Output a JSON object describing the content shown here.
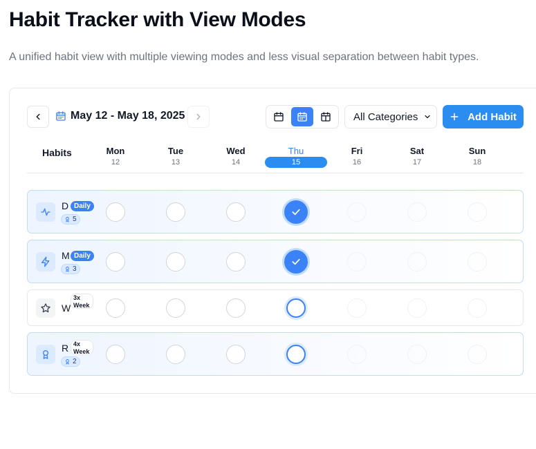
{
  "page": {
    "title": "Habit Tracker with View Modes",
    "subtitle": "A unified habit view with multiple viewing modes and less visual separation between habit types."
  },
  "toolbar": {
    "date_range": "May 12 - May 18, 2025",
    "prev_icon": "chevron-left-icon",
    "next_icon": "chevron-right-icon",
    "view_modes": [
      "day-view",
      "week-view",
      "month-view"
    ],
    "active_view": "week-view",
    "category": "All Categories",
    "add_label": "Add Habit",
    "accent": "#2b8def"
  },
  "grid": {
    "habits_header": "Habits",
    "days": [
      {
        "name": "Mon",
        "num": "12"
      },
      {
        "name": "Tue",
        "num": "13"
      },
      {
        "name": "Wed",
        "num": "14"
      },
      {
        "name": "Thu",
        "num": "15",
        "today": true
      },
      {
        "name": "Fri",
        "num": "16"
      },
      {
        "name": "Sat",
        "num": "17"
      },
      {
        "name": "Sun",
        "num": "18"
      }
    ]
  },
  "habits": [
    {
      "letter": "D",
      "icon": "activity-icon",
      "badge": "Daily",
      "badge_type": "daily",
      "streak": "5",
      "status": [
        "empty",
        "empty",
        "empty",
        "done",
        "future",
        "future",
        "future"
      ]
    },
    {
      "letter": "M",
      "icon": "lightning-icon",
      "badge": "Daily",
      "badge_type": "daily",
      "streak": "3",
      "status": [
        "empty",
        "empty",
        "empty",
        "done",
        "future",
        "future",
        "future"
      ]
    },
    {
      "letter": "W",
      "icon": "star-icon",
      "badge": "3x\nWeek",
      "badge_type": "weekly",
      "streak": "",
      "status": [
        "empty",
        "empty",
        "empty",
        "today-empty",
        "future",
        "future",
        "future"
      ]
    },
    {
      "letter": "R",
      "icon": "award-icon",
      "badge": "4x\nWeek",
      "badge_type": "weekly",
      "streak": "2",
      "status": [
        "empty",
        "empty",
        "empty",
        "today-empty",
        "future",
        "future",
        "future"
      ]
    }
  ]
}
